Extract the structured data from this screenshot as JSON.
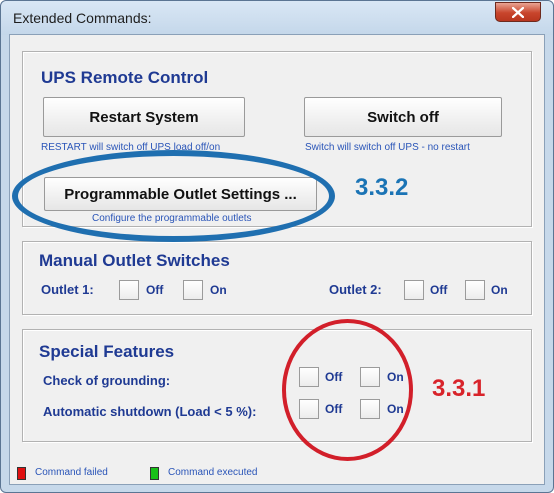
{
  "window": {
    "title": "Extended Commands:"
  },
  "ups_remote": {
    "title": "UPS Remote Control",
    "restart_label": "Restart System",
    "restart_note": "RESTART will switch off UPS load off/on",
    "switchoff_label": "Switch off",
    "switchoff_note": "Switch will switch off UPS - no restart",
    "prog_outlet_label": "Programmable Outlet Settings ...",
    "prog_outlet_note": "Configure the programmable outlets"
  },
  "manual_outlets": {
    "title": "Manual Outlet Switches",
    "outlet1_label": "Outlet 1:",
    "outlet2_label": "Outlet 2:",
    "off_label": "Off",
    "on_label": "On"
  },
  "special": {
    "title": "Special Features",
    "grounding_label": "Check of grounding:",
    "shutdown_label": "Automatic shutdown (Load < 5 %):",
    "off_label": "Off",
    "on_label": "On"
  },
  "legend": {
    "failed_label": "Command failed",
    "failed_color": "#e01010",
    "executed_label": "Command executed",
    "executed_color": "#18c018"
  },
  "annotations": {
    "blue_label": "3.3.2",
    "blue_color": "#1b74b5",
    "red_label": "3.3.1",
    "red_color": "#d8232a"
  }
}
